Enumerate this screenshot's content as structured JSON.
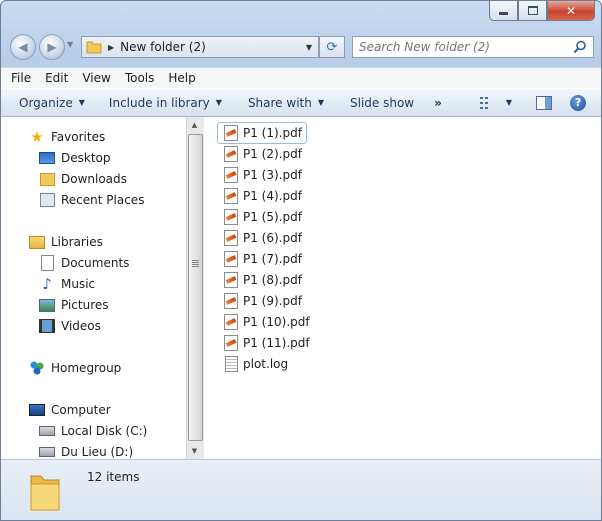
{
  "window": {
    "address_path": "New folder (2)",
    "search_placeholder": "Search New folder (2)"
  },
  "menu": [
    "File",
    "Edit",
    "View",
    "Tools",
    "Help"
  ],
  "toolbar": {
    "organize": "Organize",
    "include": "Include in library",
    "share": "Share with",
    "slideshow": "Slide show",
    "more": "»"
  },
  "nav": {
    "favorites": "Favorites",
    "desktop": "Desktop",
    "downloads": "Downloads",
    "recent": "Recent Places",
    "libraries": "Libraries",
    "documents": "Documents",
    "music": "Music",
    "pictures": "Pictures",
    "videos": "Videos",
    "homegroup": "Homegroup",
    "computer": "Computer",
    "local_disk": "Local Disk (C:)",
    "du_lieu": "Du Lieu (D:)"
  },
  "files": [
    {
      "name": "P1 (1).pdf",
      "type": "pdf"
    },
    {
      "name": "P1 (2).pdf",
      "type": "pdf"
    },
    {
      "name": "P1 (3).pdf",
      "type": "pdf"
    },
    {
      "name": "P1 (4).pdf",
      "type": "pdf"
    },
    {
      "name": "P1 (5).pdf",
      "type": "pdf"
    },
    {
      "name": "P1 (6).pdf",
      "type": "pdf"
    },
    {
      "name": "P1 (7).pdf",
      "type": "pdf"
    },
    {
      "name": "P1 (8).pdf",
      "type": "pdf"
    },
    {
      "name": "P1 (9).pdf",
      "type": "pdf"
    },
    {
      "name": "P1 (10).pdf",
      "type": "pdf"
    },
    {
      "name": "P1 (11).pdf",
      "type": "pdf"
    },
    {
      "name": "plot.log",
      "type": "log"
    }
  ],
  "status": {
    "count": "12 items"
  }
}
